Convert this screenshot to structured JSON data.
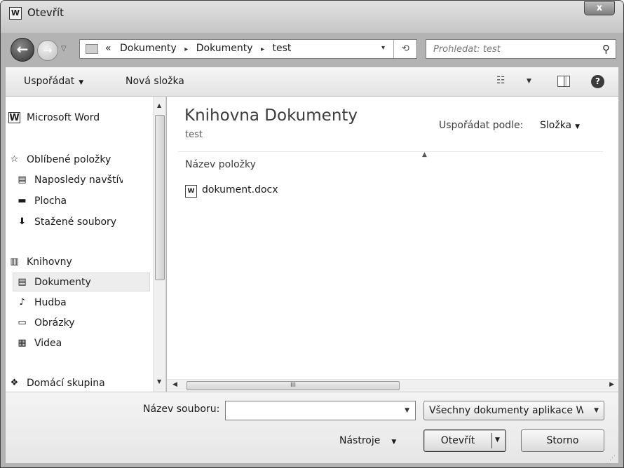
{
  "window": {
    "app_icon": "W",
    "title": "Otevřít",
    "close_glyph": "x"
  },
  "address_bar": {
    "crumbs": [
      "«",
      "Dokumenty",
      "Dokumenty",
      "test"
    ],
    "separator": "▸",
    "dropdown_glyph": "▾",
    "refresh_glyph": "⟲"
  },
  "search": {
    "placeholder": "Prohledat: test"
  },
  "toolbar": {
    "organize_label": "Uspořádat",
    "new_folder_label": "Nová složka",
    "help_glyph": "?"
  },
  "nav_pane": {
    "items": [
      {
        "label": "Microsoft Word",
        "icon": "word-icon",
        "glyph": "W"
      },
      {
        "label": "Oblíbené položky",
        "icon": "star-icon",
        "glyph": "☆"
      },
      {
        "label": "Naposledy navštívené",
        "icon": "recent-places-icon",
        "glyph": "▤"
      },
      {
        "label": "Plocha",
        "icon": "desktop-icon",
        "glyph": "▬"
      },
      {
        "label": "Stažené soubory",
        "icon": "downloads-icon",
        "glyph": "⬇"
      },
      {
        "label": "Knihovny",
        "icon": "libraries-icon",
        "glyph": "▥"
      },
      {
        "label": "Dokumenty",
        "icon": "documents-icon",
        "glyph": "▤"
      },
      {
        "label": "Hudba",
        "icon": "music-icon",
        "glyph": "♪"
      },
      {
        "label": "Obrázky",
        "icon": "pictures-icon",
        "glyph": "▭"
      },
      {
        "label": "Videa",
        "icon": "videos-icon",
        "glyph": "▦"
      },
      {
        "label": "Domácí skupina",
        "icon": "homegroup-icon",
        "glyph": "❖"
      }
    ],
    "selected": "Dokumenty"
  },
  "content": {
    "library_title": "Knihovna Dokumenty",
    "library_subtitle": "test",
    "arrange_by_label": "Uspořádat podle:",
    "arrange_by_value": "Složka",
    "column_header": "Název položky",
    "files": [
      {
        "name": "dokument.docx",
        "icon": "word-document-icon",
        "glyph": "W"
      }
    ],
    "scroll_grip": "III"
  },
  "bottom": {
    "filename_label": "Název souboru:",
    "filename_value": "",
    "filetype_value": "Všechny dokumenty aplikace Word",
    "tools_label": "Nástroje",
    "open_label": "Otevřít",
    "cancel_label": "Storno"
  }
}
